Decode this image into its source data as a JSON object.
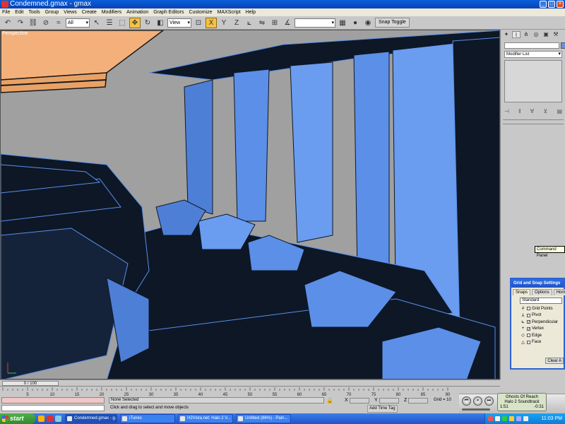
{
  "window": {
    "title": "Condemned.gmax - gmax",
    "controls": [
      "_",
      "□",
      "×"
    ]
  },
  "menu": [
    "File",
    "Edit",
    "Tools",
    "Group",
    "Views",
    "Create",
    "Modifiers",
    "Animation",
    "Graph Editors",
    "Customize",
    "MAXScript",
    "Help"
  ],
  "toolbar": {
    "selection_filter": "All",
    "coord_system": "View",
    "named_selection": "",
    "snap_toggle_label": "Snap Toggle"
  },
  "viewport": {
    "label": "Perspective",
    "colors": {
      "background": "#a0a0a0",
      "blue_face": "#5b8fe8",
      "dark_face": "#0d1726",
      "orange": "#f4b07a"
    }
  },
  "command_panel": {
    "modifier_list": "Modifier List",
    "tooltip": "Command Panel"
  },
  "snap_dialog": {
    "title": "Grid and Snap Settings",
    "tabs": [
      "Snaps",
      "Options",
      "Home"
    ],
    "preset": "Standard",
    "items": [
      {
        "glyph": "#",
        "label": "Grid Points",
        "checked": false
      },
      {
        "glyph": "⅄",
        "label": "Pivot",
        "checked": false
      },
      {
        "glyph": "⊾",
        "label": "Perpendicular",
        "checked": true
      },
      {
        "glyph": "+",
        "label": "Vertex",
        "checked": true
      },
      {
        "glyph": "◇",
        "label": "Edge",
        "checked": false
      },
      {
        "glyph": "△",
        "label": "Face",
        "checked": false
      }
    ],
    "clear_all": "Clear A"
  },
  "timeline": {
    "slider_label": "0 / 100",
    "ticks": [
      "5",
      "10",
      "15",
      "20",
      "25",
      "30",
      "35",
      "40",
      "45",
      "50",
      "55",
      "60",
      "65",
      "70",
      "75",
      "80",
      "85",
      "90"
    ]
  },
  "status": {
    "selection": "None Selected",
    "prompt": "Click and drag to select and move objects",
    "x_label": "X",
    "y_label": "Y",
    "z_label": "Z",
    "grid": "Grid = 10",
    "add_time_tag": "Add Time Tag"
  },
  "media": {
    "track": "Ghosts Of Reach",
    "album": "Halo 2 Soundtrack",
    "elapsed": "1:51",
    "remaining": "-0:31"
  },
  "taskbar": {
    "start": "start",
    "tasks": [
      "Condemned.gmax - g...",
      "iTunes",
      "H2Vista.net: Halo 2 V...",
      "Untitled (86%) - Pain..."
    ],
    "clock": "11:03 PM"
  }
}
